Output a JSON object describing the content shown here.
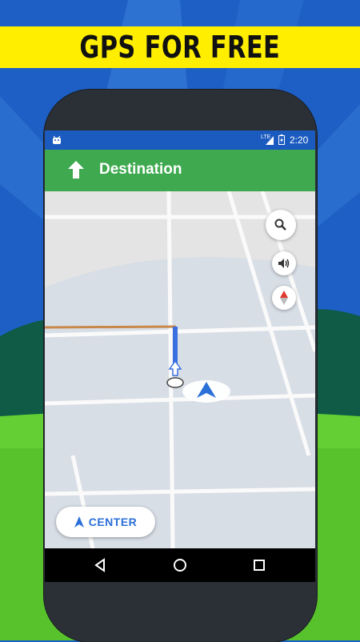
{
  "banner": {
    "title": "GPS FOR FREE"
  },
  "status_bar": {
    "time": "2:20",
    "network": "LTE"
  },
  "navigation": {
    "destination": "Destination"
  },
  "map_controls": {
    "center_label": "CENTER"
  },
  "icons": [
    "android-icon",
    "signal-icon",
    "battery-icon",
    "up-arrow-icon",
    "search-icon",
    "volume-icon",
    "compass-icon",
    "navigation-arrow-icon",
    "back-icon",
    "home-icon",
    "recents-icon"
  ],
  "colors": {
    "banner": "#ffee00",
    "header_green": "#3ea94f",
    "status_blue": "#1b5bc0",
    "accent_blue": "#2b6fd8",
    "route_blue": "#3b6fe0",
    "route_orange": "#c8884a"
  }
}
